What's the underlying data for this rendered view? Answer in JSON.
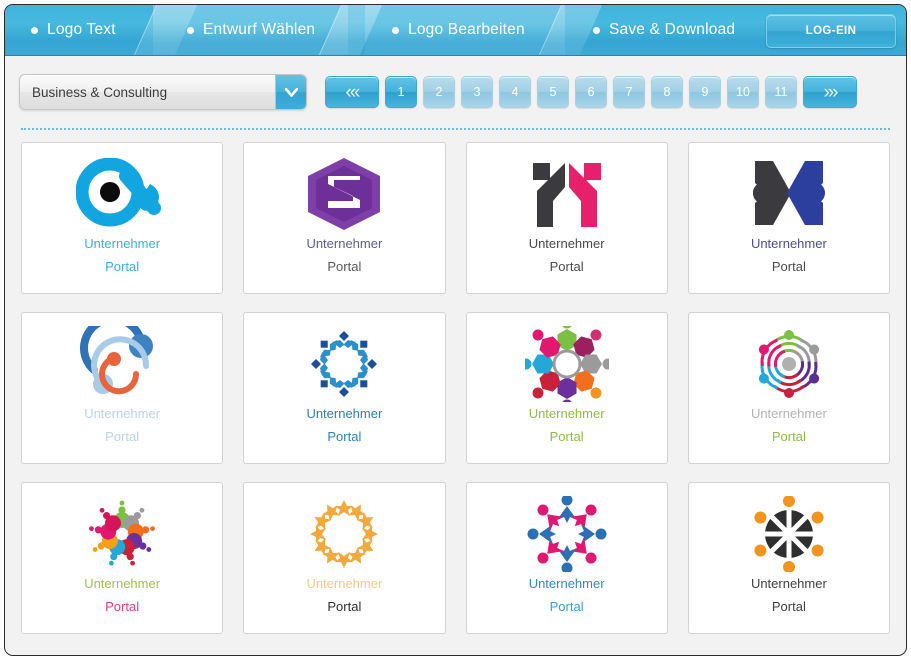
{
  "header": {
    "steps": [
      {
        "label": "Logo Text",
        "bullet": "dot-icon"
      },
      {
        "label": "Entwurf Wählen",
        "bullet": "dot-icon"
      },
      {
        "label": "Logo Bearbeiten",
        "bullet": "dot-icon"
      },
      {
        "label": "Save & Download",
        "bullet": "dot-icon"
      }
    ],
    "login_label": "LOG-EIN",
    "bar_color": "#3fb3dc"
  },
  "toolbar": {
    "category": {
      "selected": "Business & Consulting",
      "icon": "chevron-down-icon"
    },
    "pagination": {
      "prev_glyph": "«‹",
      "next_glyph": "›»",
      "prev_name": "first-page",
      "next_name": "last-page",
      "active_page": "1",
      "pages": [
        "1",
        "2",
        "3",
        "4",
        "5",
        "6",
        "7",
        "8",
        "9",
        "10",
        "11"
      ]
    }
  },
  "grid": {
    "cards": [
      {
        "icon": "infinity-eye-logo",
        "line1": "Unternehmer",
        "line2": "Portal",
        "line1_color": "#3aafe2",
        "line2_color": "#3aafe2"
      },
      {
        "icon": "hexagon-s-logo",
        "line1": "Unternehmer",
        "line2": "Portal",
        "line1_color": "#5b5f8a",
        "line2_color": "#5a5a5a"
      },
      {
        "icon": "m-letter-logo",
        "line1": "Unternehmer",
        "line2": "Portal",
        "line1_color": "#4a4a4a",
        "line2_color": "#4a4a4a"
      },
      {
        "icon": "n-people-logo",
        "line1": "Unternehmer",
        "line2": "Portal",
        "line2_color": "#4a4a4a",
        "line1_color": "#4a4f99"
      },
      {
        "icon": "orbit-circles-logo",
        "line1": "Unternehmer",
        "line2": "Portal",
        "line1_color": "#b9d4e6",
        "line2_color": "#b9d4e6"
      },
      {
        "icon": "snowflake-people-logo",
        "line1": "Unternehmer",
        "line2": "Portal",
        "line1_color": "#2d7fb8",
        "line2_color": "#2d7fb8"
      },
      {
        "icon": "hexagon-ring-logo",
        "line1": "Unternehmer",
        "line2": "Portal",
        "line1_color": "#8bbf3f",
        "line2_color": "#8bbf3f"
      },
      {
        "icon": "radial-waves-logo",
        "line1": "Unternehmer",
        "line2": "Portal",
        "line1_color": "#b3b3b3",
        "line2_color": "#8bbf3f"
      },
      {
        "icon": "dot-burst-logo",
        "line1": "Unternehmer",
        "line2": "Portal",
        "line1_color": "#9ec24a",
        "line2_color": "#e0407f"
      },
      {
        "icon": "star-ring-logo",
        "line1": "Unternehmer",
        "line2": "Portal",
        "line1_color": "#f3c98a",
        "line2_color": "#2f2f2f"
      },
      {
        "icon": "people-circle-logo",
        "line1": "Unternehmer",
        "line2": "Portal",
        "line1_color": "#3a86c8",
        "line2_color": "#3a9fdc"
      },
      {
        "icon": "black-wheel-logo",
        "line1": "Unternehmer",
        "line2": "Portal",
        "line1_color": "#3f3f3f",
        "line2_color": "#3f3f3f"
      }
    ]
  },
  "colors": {
    "accent": "#3fb3dc",
    "page_bg": "#f2f2f2",
    "card_border": "#d2d2d2",
    "divider": "#3ba9d6"
  }
}
